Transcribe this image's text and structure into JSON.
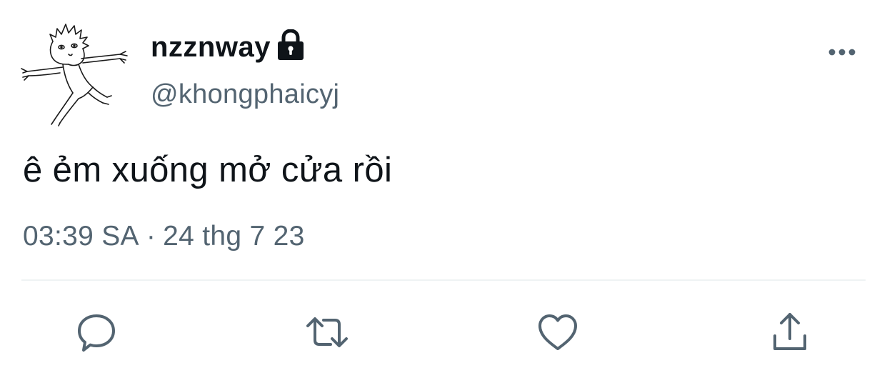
{
  "tweet": {
    "display_name": "nzznway",
    "handle": "@khongphaicyj",
    "text": "ê ẻm xuống mở cửa rồi",
    "time": "03:39 SA",
    "separator": "·",
    "date": "24 thg 7 23",
    "protected": true
  },
  "icons": {
    "avatar": "stick-figure-drawing",
    "lock": "lock-icon",
    "more": "more-options-icon",
    "reply": "reply-icon",
    "retweet": "retweet-icon",
    "like": "heart-icon",
    "share": "share-icon"
  },
  "colors": {
    "text_primary": "#0f1419",
    "text_secondary": "#536471",
    "divider": "#eff3f4",
    "background": "#ffffff"
  }
}
